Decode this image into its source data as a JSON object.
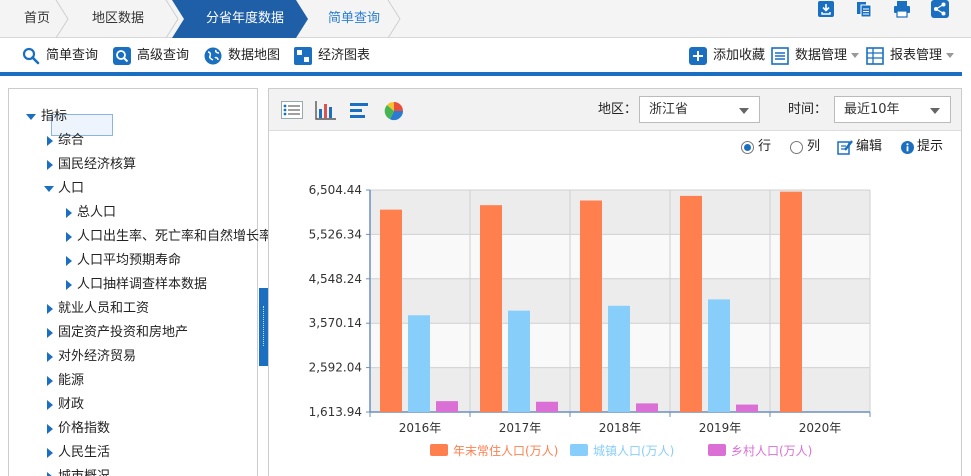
{
  "breadcrumb": {
    "items": [
      "首页",
      "地区数据",
      "分省年度数据",
      "简单查询"
    ]
  },
  "header_icons": [
    "download-icon",
    "copy-icon",
    "print-icon",
    "share-icon"
  ],
  "toolbar": {
    "left": [
      {
        "label": "简单查询",
        "icon": "search-icon"
      },
      {
        "label": "高级查询",
        "icon": "advanced-search-icon"
      },
      {
        "label": "数据地图",
        "icon": "map-icon"
      },
      {
        "label": "经济图表",
        "icon": "chart-icon"
      }
    ],
    "right": [
      {
        "label": "添加收藏",
        "icon": "plus-icon"
      },
      {
        "label": "数据管理",
        "icon": "data-manage-icon"
      },
      {
        "label": "报表管理",
        "icon": "report-icon"
      }
    ]
  },
  "tree": {
    "root": "指标",
    "items": [
      {
        "label": "综合"
      },
      {
        "label": "国民经济核算"
      },
      {
        "label": "人口",
        "expanded": true,
        "children": [
          {
            "label": "总人口",
            "selected": true
          },
          {
            "label": "人口出生率、死亡率和自然增长率"
          },
          {
            "label": "人口平均预期寿命"
          },
          {
            "label": "人口抽样调查样本数据"
          }
        ]
      },
      {
        "label": "就业人员和工资"
      },
      {
        "label": "固定资产投资和房地产"
      },
      {
        "label": "对外经济贸易"
      },
      {
        "label": "能源"
      },
      {
        "label": "财政"
      },
      {
        "label": "价格指数"
      },
      {
        "label": "人民生活"
      },
      {
        "label": "城市概况"
      }
    ]
  },
  "view_icons": [
    "table-view-icon",
    "bar-chart-icon",
    "horizontal-bar-icon",
    "pie-chart-icon"
  ],
  "filters": {
    "region_label": "地区：",
    "region_value": "浙江省",
    "time_label": "时间：",
    "time_value": "最近10年"
  },
  "options": {
    "row": "行",
    "col": "列",
    "edit": "编辑",
    "tip": "提示",
    "selected": "row"
  },
  "colors": {
    "accent": "#1a6fc0",
    "series_1": "#ff7f4f",
    "series_2": "#87cefa",
    "series_3": "#da70d6"
  },
  "chart_data": {
    "type": "bar",
    "categories": [
      "2016年",
      "2017年",
      "2018年",
      "2019年",
      "2020年"
    ],
    "series": [
      {
        "name": "年末常住人口(万人)",
        "values": [
          6072,
          6170,
          6273,
          6375,
          6468
        ]
      },
      {
        "name": "城镇人口(万人)",
        "values": [
          3745,
          3847,
          3953,
          4095,
          null
        ]
      },
      {
        "name": "乡村人口(万人)",
        "values": [
          1853,
          1840,
          1804,
          1778,
          null
        ]
      }
    ],
    "yticks": [
      "1,613.94",
      "2,592.04",
      "3,570.14",
      "4,548.24",
      "5,526.34",
      "6,504.44"
    ],
    "ylim": [
      1613.94,
      6504.44
    ],
    "grid": true,
    "legend": "bottom"
  }
}
